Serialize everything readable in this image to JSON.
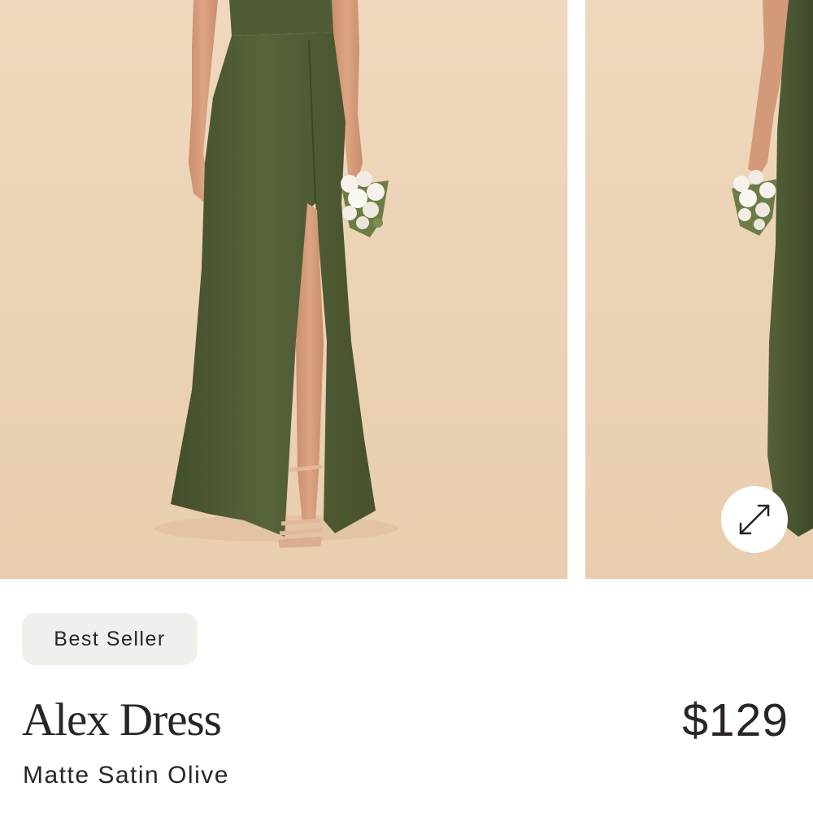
{
  "gallery": {
    "images": [
      {
        "alt": "Alex Dress in Matte Satin Olive, front view"
      },
      {
        "alt": "Alex Dress in Matte Satin Olive, side view"
      }
    ],
    "expand_icon": "expand-arrows-icon"
  },
  "product": {
    "badge": "Best Seller",
    "name": "Alex Dress",
    "price": "$129",
    "variant": "Matte Satin Olive"
  },
  "colors": {
    "background": "#ecd3b6",
    "dress": "#4e5a34",
    "text": "#2a2523",
    "badge_bg": "#f1efeb"
  }
}
